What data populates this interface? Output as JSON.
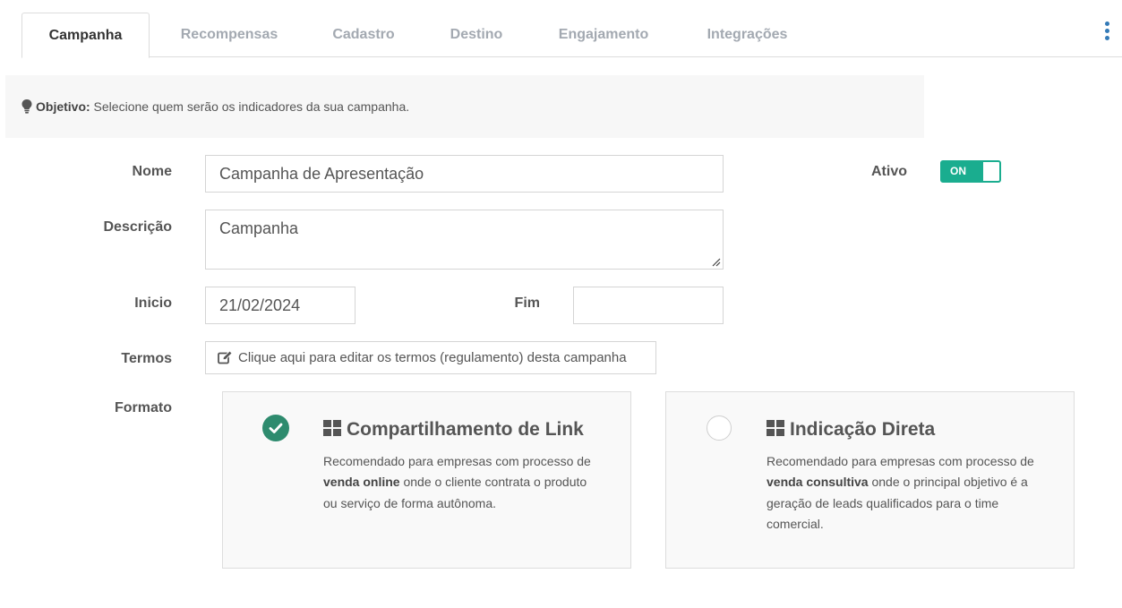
{
  "tabs": [
    {
      "label": "Campanha",
      "active": true
    },
    {
      "label": "Recompensas",
      "active": false
    },
    {
      "label": "Cadastro",
      "active": false
    },
    {
      "label": "Destino",
      "active": false
    },
    {
      "label": "Engajamento",
      "active": false
    },
    {
      "label": "Integrações",
      "active": false
    }
  ],
  "objective": {
    "label": "Objetivo:",
    "text": " Selecione quem serão os indicadores da sua campanha."
  },
  "form": {
    "nome_label": "Nome",
    "nome_value": "Campanha de Apresentação",
    "ativo_label": "Ativo",
    "ativo_toggle": "ON",
    "descricao_label": "Descrição",
    "descricao_value": "Campanha",
    "inicio_label": "Inicio",
    "inicio_value": "21/02/2024",
    "fim_label": "Fim",
    "fim_value": "",
    "termos_label": "Termos",
    "termos_button": "Clique aqui para editar os termos (regulamento) desta campanha",
    "formato_label": "Formato"
  },
  "formats": [
    {
      "title": "Compartilhamento de Link",
      "selected": true,
      "desc_pre": "Recomendado para empresas com processo de ",
      "desc_bold": "venda online",
      "desc_post": " onde o cliente contrata o produto ou serviço de forma autônoma."
    },
    {
      "title": "Indicação Direta",
      "selected": false,
      "desc_pre": "Recomendado para empresas com processo de ",
      "desc_bold": "venda consultiva",
      "desc_post": " onde o principal objetivo é a geração de leads qualificados para o time comercial."
    }
  ],
  "colors": {
    "accent": "#1aad8f",
    "check": "#2e8b6e",
    "kebab": "#337ab7"
  },
  "icons": [
    "lightbulb-icon",
    "edit-icon",
    "check-icon",
    "grid-icon",
    "kebab-menu-icon"
  ]
}
